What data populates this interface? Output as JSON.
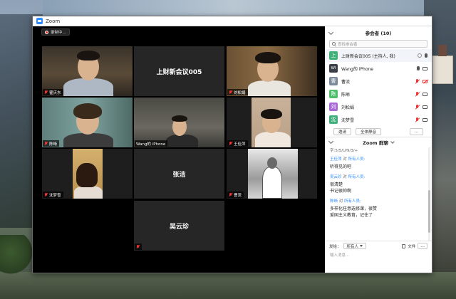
{
  "window": {
    "title": "Zoom"
  },
  "recording": {
    "label": "录制中..."
  },
  "tiles": [
    {
      "name": "瞿庆东",
      "muted": true,
      "type": "video"
    },
    {
      "name": "上财新会议005",
      "muted": false,
      "type": "label"
    },
    {
      "name": "刘松娟",
      "muted": true,
      "type": "video"
    },
    {
      "name": "陈晰",
      "muted": true,
      "type": "video"
    },
    {
      "name": "Wang的 iPhone",
      "muted": false,
      "type": "video",
      "active": true
    },
    {
      "name": "王佳萍",
      "muted": true,
      "type": "video"
    },
    {
      "name": "沈梦雪",
      "muted": true,
      "type": "video"
    },
    {
      "name": "张洁",
      "muted": false,
      "type": "label"
    },
    {
      "name": "曹流",
      "muted": true,
      "type": "video"
    },
    {
      "name": "吴云珍",
      "muted": true,
      "type": "label"
    }
  ],
  "participants_panel": {
    "title": "参会者 (10)",
    "search_placeholder": "查找参会者",
    "items": [
      {
        "initial": "上",
        "name": "上财新会议005 (主持人, 我)",
        "color": "#3fb07a"
      },
      {
        "initial": "WI",
        "name": "Wang的 iPhone",
        "color": "#3a3f47"
      },
      {
        "initial": "曹",
        "name": "曹流",
        "color": "#7a8a9a"
      },
      {
        "initial": "陈",
        "name": "陈晰",
        "color": "#4cbf6a"
      },
      {
        "initial": "刘",
        "name": "刘松娟",
        "color": "#a96ad8"
      },
      {
        "initial": "沈",
        "name": "沈梦雪",
        "color": "#3fb07a"
      }
    ],
    "invite_label": "邀请",
    "mute_all_label": "全体静音",
    "more_label": "..."
  },
  "chat": {
    "title": "Zoom 群聊",
    "truncated_line": "字:5/5/U/9/3/+",
    "messages": [
      {
        "sender": "王佳萍",
        "to_word": "对",
        "recipient": "所有人员:",
        "text": "听得见的吧"
      },
      {
        "sender": "吴云珍",
        "to_word": "对",
        "recipient": "所有人员:",
        "text": "很清楚\n书记很帅啊"
      },
      {
        "sender": "陈晰",
        "to_word": "对",
        "recipient": "所有人员:",
        "text": "多样化任意选修课，很赞\n爱国主义教育，记住了"
      }
    ],
    "send_to_label": "发给：",
    "send_to_value": "所有人",
    "file_label": "文件",
    "more_label": "...",
    "input_placeholder": "输入消息..."
  }
}
